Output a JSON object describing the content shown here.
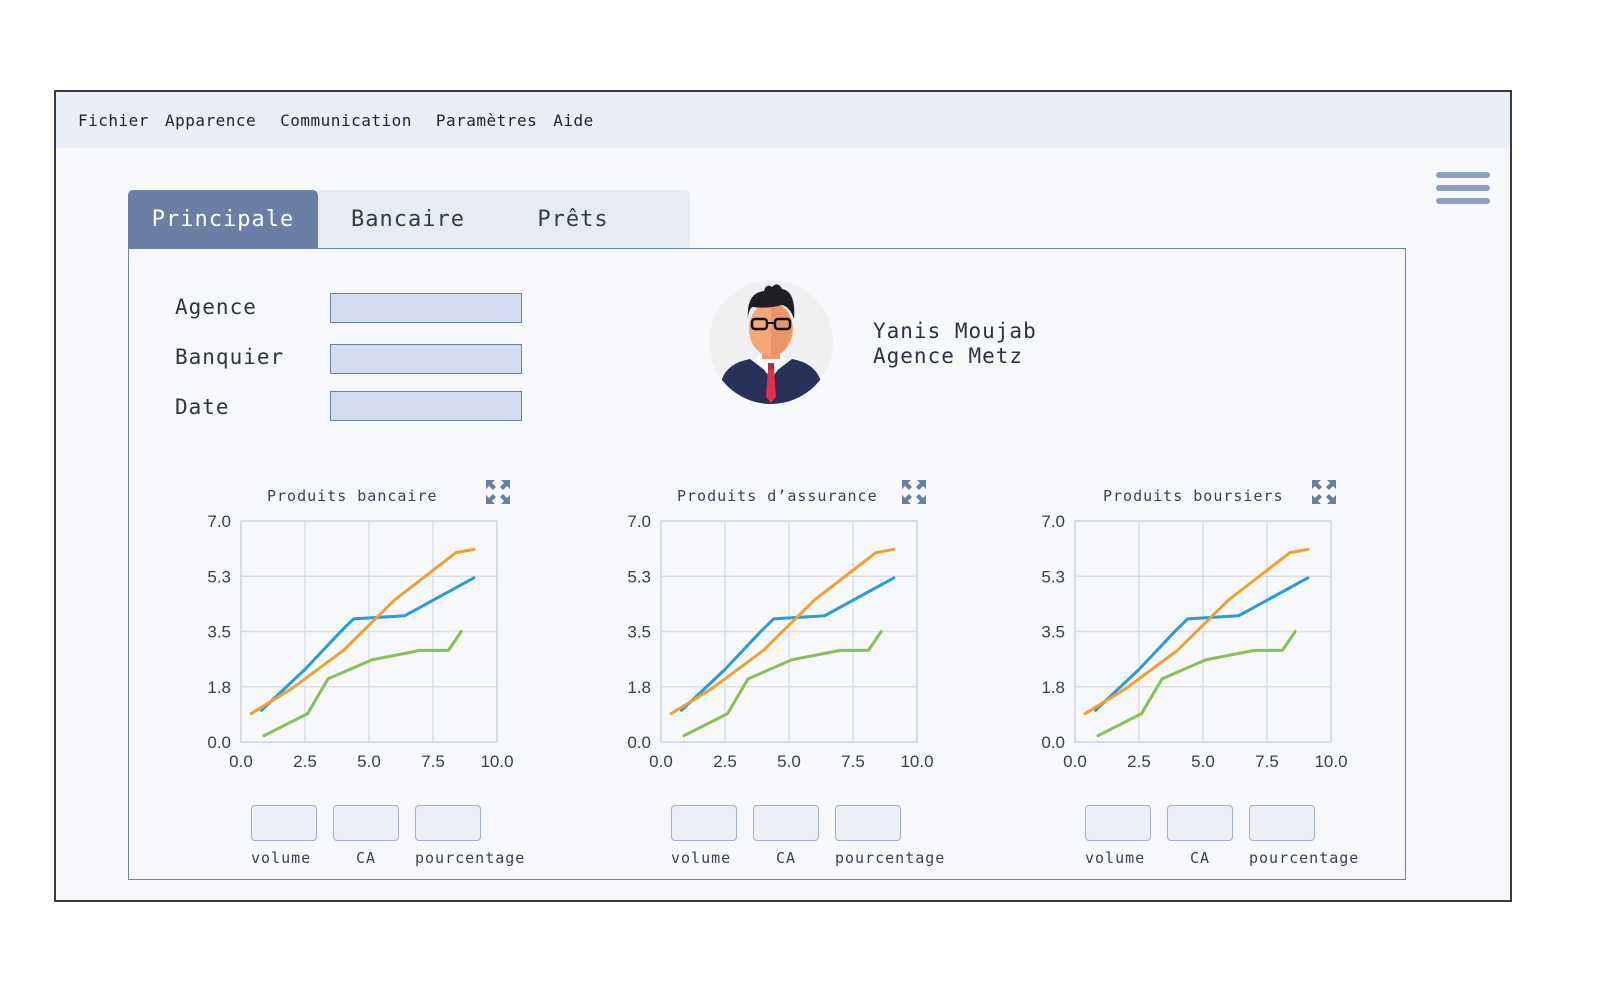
{
  "menubar": {
    "items": [
      "Fichier",
      "Apparence",
      "Communication",
      "Paramètres",
      "Aide"
    ]
  },
  "tabs": [
    {
      "label": "Principale",
      "active": true
    },
    {
      "label": "Bancaire",
      "active": false
    },
    {
      "label": "Prêts",
      "active": false
    }
  ],
  "form": {
    "agence_label": "Agence",
    "banquier_label": "Banquier",
    "date_label": "Date"
  },
  "user": {
    "name": "Yanis Moujab",
    "agency": "Agence Metz"
  },
  "colors": {
    "accent": "#6b7ea6",
    "series": [
      "#2a9ad8",
      "#f0a030",
      "#86c057"
    ]
  },
  "charts": [
    {
      "title": "Produits bancaire",
      "buttons": [
        "volume",
        "CA",
        "pourcentage"
      ]
    },
    {
      "title": "Produits d’assurance",
      "buttons": [
        "volume",
        "CA",
        "pourcentage"
      ]
    },
    {
      "title": "Produits boursiers",
      "buttons": [
        "volume",
        "CA",
        "pourcentage"
      ]
    }
  ],
  "chart_data": [
    {
      "type": "line",
      "title": "Produits bancaire",
      "xlim": [
        0,
        10
      ],
      "ylim": [
        0,
        7
      ],
      "xticks": [
        "0.0",
        "2.5",
        "5.0",
        "7.5",
        "10.0"
      ],
      "yticks": [
        "0.0",
        "1.8",
        "3.5",
        "5.3",
        "7.0"
      ],
      "grid": true,
      "series": [
        {
          "x": [
            0.8,
            2.5,
            3.9,
            4.4,
            6.4,
            9.1
          ],
          "y": [
            1.0,
            2.3,
            3.5,
            3.9,
            4.0,
            5.2
          ]
        },
        {
          "x": [
            0.4,
            2.0,
            4.0,
            6.0,
            8.4,
            9.1
          ],
          "y": [
            0.9,
            1.7,
            2.9,
            4.5,
            6.0,
            6.1
          ]
        },
        {
          "x": [
            0.9,
            2.6,
            3.4,
            5.1,
            7.0,
            8.1,
            8.6
          ],
          "y": [
            0.2,
            0.9,
            2.0,
            2.6,
            2.9,
            2.9,
            3.5
          ]
        }
      ]
    },
    {
      "type": "line",
      "title": "Produits d’assurance",
      "xlim": [
        0,
        10
      ],
      "ylim": [
        0,
        7
      ],
      "xticks": [
        "0.0",
        "2.5",
        "5.0",
        "7.5",
        "10.0"
      ],
      "yticks": [
        "0.0",
        "1.8",
        "3.5",
        "5.3",
        "7.0"
      ],
      "grid": true,
      "series": [
        {
          "x": [
            0.8,
            2.5,
            3.9,
            4.4,
            6.4,
            9.1
          ],
          "y": [
            1.0,
            2.3,
            3.5,
            3.9,
            4.0,
            5.2
          ]
        },
        {
          "x": [
            0.4,
            2.0,
            4.0,
            6.0,
            8.4,
            9.1
          ],
          "y": [
            0.9,
            1.7,
            2.9,
            4.5,
            6.0,
            6.1
          ]
        },
        {
          "x": [
            0.9,
            2.6,
            3.4,
            5.1,
            7.0,
            8.1,
            8.6
          ],
          "y": [
            0.2,
            0.9,
            2.0,
            2.6,
            2.9,
            2.9,
            3.5
          ]
        }
      ]
    },
    {
      "type": "line",
      "title": "Produits boursiers",
      "xlim": [
        0,
        10
      ],
      "ylim": [
        0,
        7
      ],
      "xticks": [
        "0.0",
        "2.5",
        "5.0",
        "7.5",
        "10.0"
      ],
      "yticks": [
        "0.0",
        "1.8",
        "3.5",
        "5.3",
        "7.0"
      ],
      "grid": true,
      "series": [
        {
          "x": [
            0.8,
            2.5,
            3.9,
            4.4,
            6.4,
            9.1
          ],
          "y": [
            1.0,
            2.3,
            3.5,
            3.9,
            4.0,
            5.2
          ]
        },
        {
          "x": [
            0.4,
            2.0,
            4.0,
            6.0,
            8.4,
            9.1
          ],
          "y": [
            0.9,
            1.7,
            2.9,
            4.5,
            6.0,
            6.1
          ]
        },
        {
          "x": [
            0.9,
            2.6,
            3.4,
            5.1,
            7.0,
            8.1,
            8.6
          ],
          "y": [
            0.2,
            0.9,
            2.0,
            2.6,
            2.9,
            2.9,
            3.5
          ]
        }
      ]
    }
  ]
}
